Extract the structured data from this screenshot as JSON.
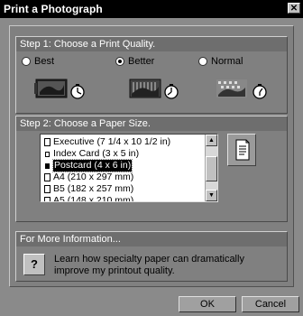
{
  "window": {
    "title": "Print a Photograph",
    "close_glyph": "✕"
  },
  "step1": {
    "header": "Step 1:  Choose a Print Quality.",
    "options": [
      {
        "label": "Best",
        "selected": false
      },
      {
        "label": "Better",
        "selected": true
      },
      {
        "label": "Normal",
        "selected": false
      }
    ]
  },
  "step2": {
    "header": "Step 2:  Choose a Paper Size.",
    "items": [
      {
        "label": "Executive (7 1/4 x 10 1/2 in)",
        "icon": "page-icon",
        "selected": false
      },
      {
        "label": "Index Card (3 x 5 in)",
        "icon": "small-card-icon",
        "selected": false
      },
      {
        "label": "Postcard (4 x 6 in)",
        "icon": "postcard-icon",
        "selected": true
      },
      {
        "label": "A4 (210 x 297 mm)",
        "icon": "page-icon",
        "selected": false
      },
      {
        "label": "B5 (182 x 257 mm)",
        "icon": "page-icon",
        "selected": false
      },
      {
        "label": "A5 (148 x 210 mm)",
        "icon": "page-icon",
        "selected": false
      }
    ]
  },
  "info": {
    "header": "For More Information...",
    "button": "?",
    "text": "Learn how specialty paper can dramatically improve my printout quality."
  },
  "buttons": {
    "ok": "OK",
    "cancel": "Cancel"
  }
}
